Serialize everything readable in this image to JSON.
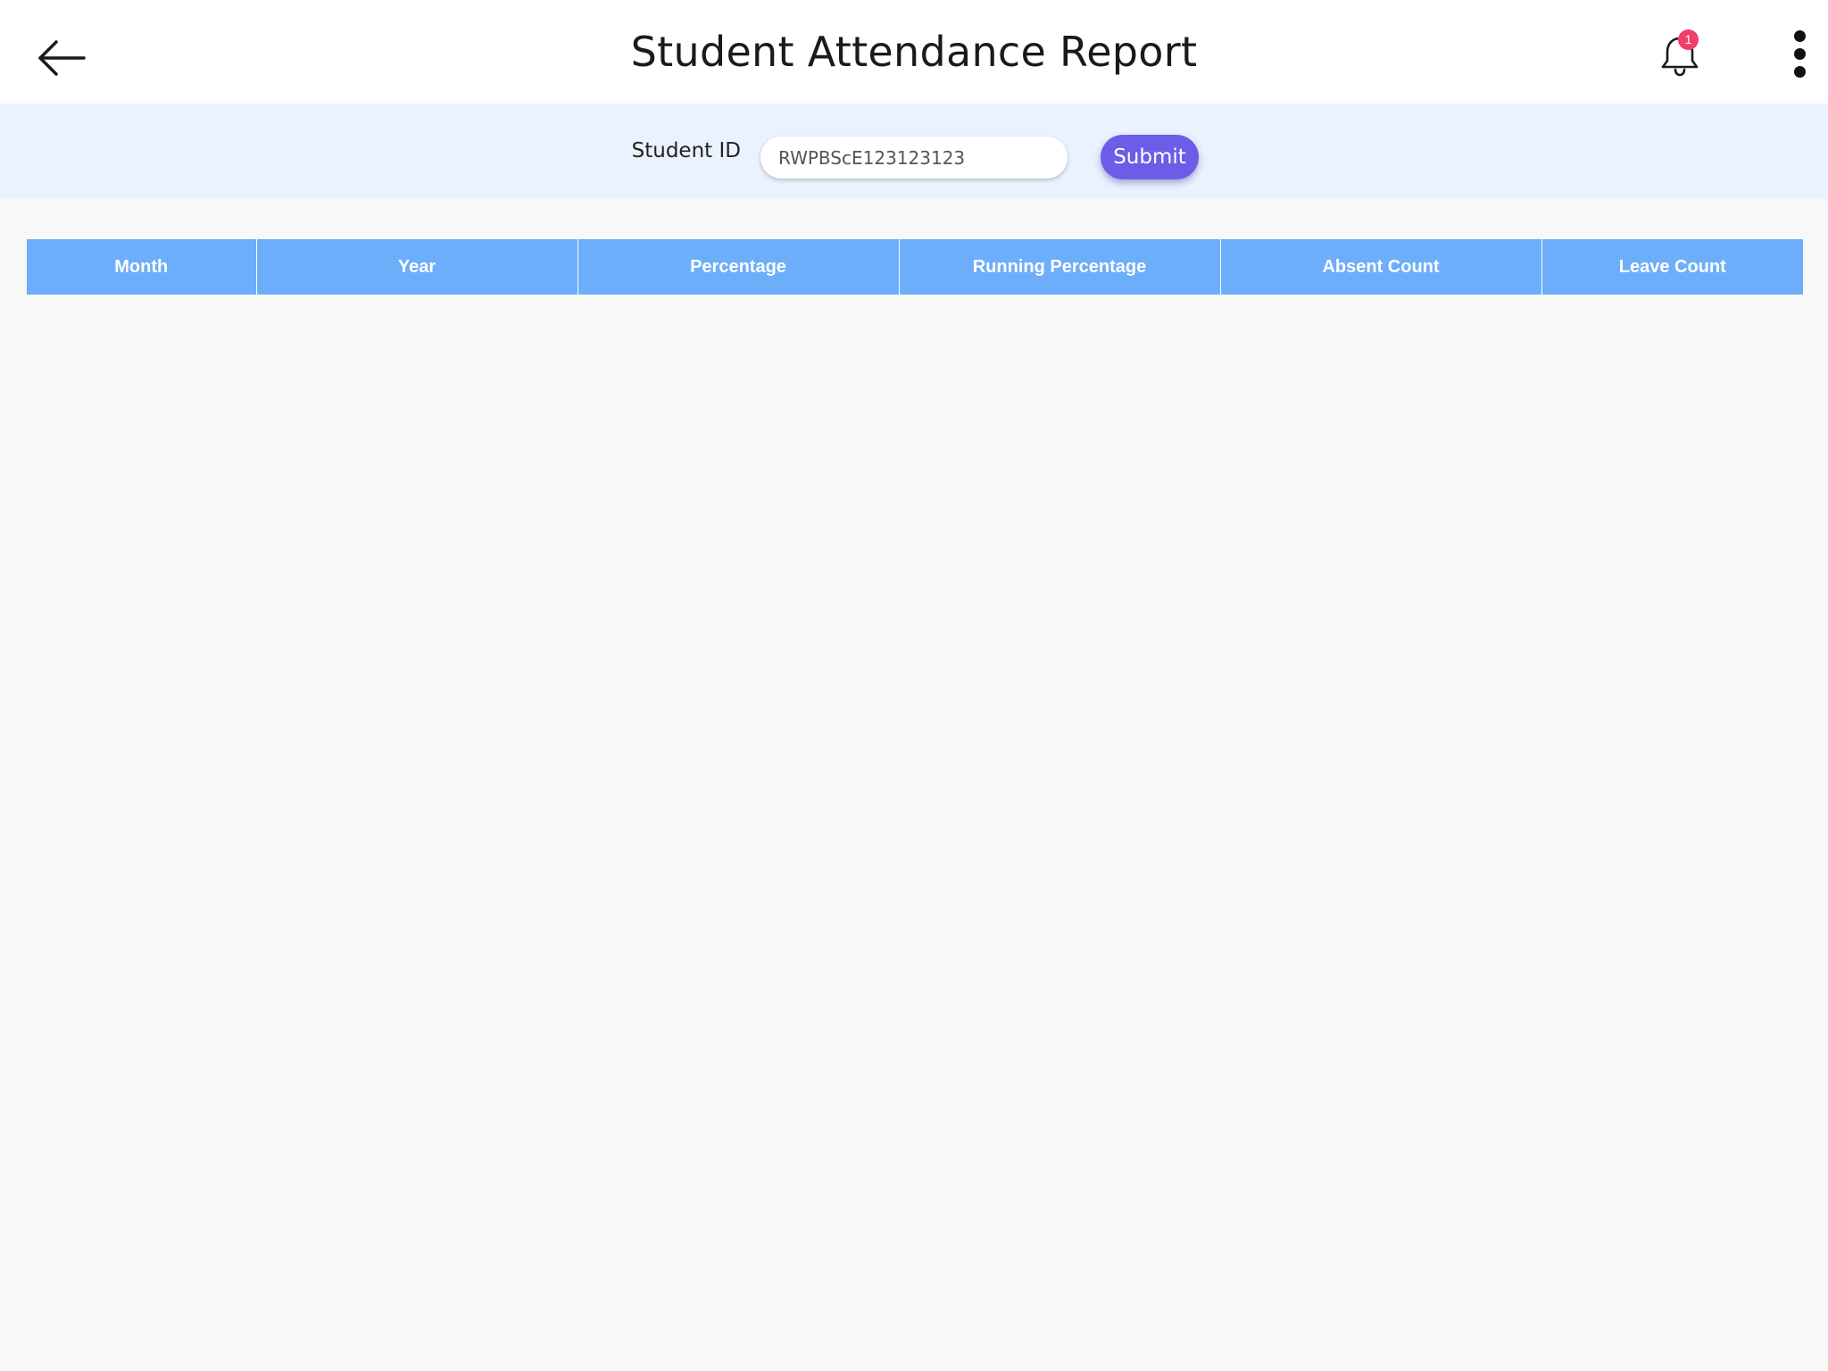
{
  "header": {
    "title": "Student Attendance Report",
    "back_icon": "arrow-left-icon",
    "notification_icon": "bell-icon",
    "notification_count": "1",
    "menu_icon": "more-vertical-icon"
  },
  "filter": {
    "student_id_label": "Student ID",
    "student_id_value": "RWPBScE123123123",
    "submit_label": "Submit"
  },
  "table": {
    "columns": [
      "Month",
      "Year",
      "Percentage",
      "Running Percentage",
      "Absent Count",
      "Leave Count"
    ],
    "rows": []
  },
  "colors": {
    "accent": "#6c5ce7",
    "table_header": "#6daefa",
    "filter_background": "#eaf2ff",
    "badge": "#f23d6a"
  }
}
